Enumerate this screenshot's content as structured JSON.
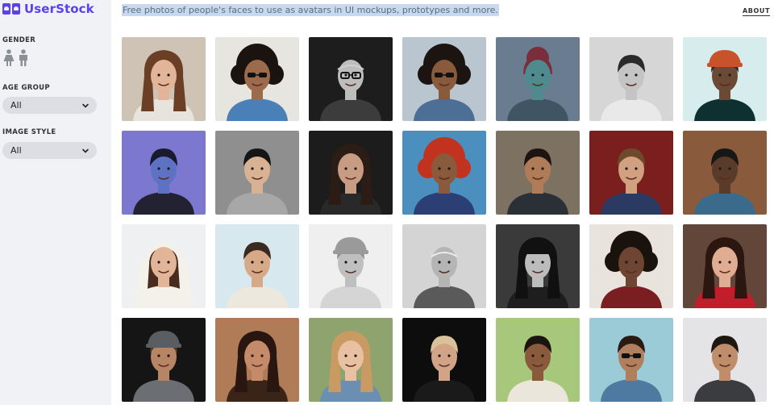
{
  "app": {
    "name": "UserStock",
    "brand_color": "#5b3ff0"
  },
  "sidebar": {
    "gender": {
      "label": "GENDER",
      "icons": [
        "female-person-icon",
        "male-person-icon"
      ]
    },
    "age_group": {
      "label": "AGE GROUP",
      "selected": "All"
    },
    "image_style": {
      "label": "IMAGE STYLE",
      "selected": "All"
    }
  },
  "header": {
    "tagline": "Free photos of people's faces to use as avatars in UI mockups, prototypes and more.",
    "about": "ABOUT"
  },
  "photos": [
    {
      "bg": "#cfc3b5",
      "skin": "#e2b598",
      "hair": "#6a3f25",
      "shirt": "#e6e4dc",
      "hairStyle": "long",
      "glasses": false,
      "hat": null
    },
    {
      "bg": "#e7e5e0",
      "skin": "#9c6b4c",
      "hair": "#1b1310",
      "shirt": "#4a80b7",
      "hairStyle": "curly",
      "glasses": "sun",
      "hat": null
    },
    {
      "bg": "#1d1d1d",
      "skin": "#bdbdbd",
      "hair": "#cfcfcf",
      "shirt": "#3c3c3c",
      "hairStyle": "bald",
      "glasses": "clear",
      "hat": null
    },
    {
      "bg": "#b9c6cf",
      "skin": "#8a5a3d",
      "hair": "#1c1410",
      "shirt": "#4d6f96",
      "hairStyle": "curly",
      "glasses": "sun",
      "hat": null
    },
    {
      "bg": "#6a7d90",
      "skin": "#4f8a8f",
      "hair": "#7a2e3c",
      "shirt": "#3f5563",
      "hairStyle": "bun",
      "glasses": false,
      "hat": null
    },
    {
      "bg": "#d6d6d6",
      "skin": "#c4c4c4",
      "hair": "#2a2a2a",
      "shirt": "#e9e9e9",
      "hairStyle": "short",
      "glasses": false,
      "hat": null
    },
    {
      "bg": "#d7ecec",
      "skin": "#6b4a35",
      "hair": "#3a2a20",
      "shirt": "#0f3030",
      "hairStyle": "short",
      "glasses": false,
      "hat": "#c8532b"
    },
    {
      "bg": "#7c77cf",
      "skin": "#5e72c4",
      "hair": "#1a1a2e",
      "shirt": "#222233",
      "hairStyle": "short",
      "glasses": false,
      "hat": null
    },
    {
      "bg": "#8f8f8f",
      "skin": "#d8b293",
      "hair": "#151515",
      "shirt": "#a7a7a7",
      "hairStyle": "short",
      "glasses": false,
      "hat": null
    },
    {
      "bg": "#1c1c1c",
      "skin": "#c89c82",
      "hair": "#2b1d16",
      "shirt": "#292929",
      "hairStyle": "long",
      "glasses": false,
      "hat": null
    },
    {
      "bg": "#4a8fbd",
      "skin": "#8a5a3d",
      "hair": "#c2331f",
      "shirt": "#2c3f74",
      "hairStyle": "curly",
      "glasses": false,
      "hat": null
    },
    {
      "bg": "#7d7261",
      "skin": "#b07c58",
      "hair": "#1c1410",
      "shirt": "#2a3036",
      "hairStyle": "short",
      "glasses": false,
      "hat": null
    },
    {
      "bg": "#7a1e1e",
      "skin": "#d1a07f",
      "hair": "#6e4a2c",
      "shirt": "#2b3a63",
      "hairStyle": "short",
      "glasses": false,
      "hat": null
    },
    {
      "bg": "#8a5a3c",
      "skin": "#5a3a28",
      "hair": "#171717",
      "shirt": "#3b6b8c",
      "hairStyle": "short",
      "glasses": false,
      "hat": null
    },
    {
      "bg": "#eef0f2",
      "skin": "#e2b598",
      "hair": "#4a2c1e",
      "shirt": "#f4f1ea",
      "hairStyle": "hood",
      "glasses": false,
      "hat": null
    },
    {
      "bg": "#d7e8ef",
      "skin": "#d6aa88",
      "hair": "#3a2a20",
      "shirt": "#ece8de",
      "hairStyle": "short",
      "glasses": false,
      "hat": null
    },
    {
      "bg": "#efefef",
      "skin": "#bfbfbf",
      "hair": "#8e8e8e",
      "shirt": "#d5d5d5",
      "hairStyle": "short",
      "glasses": false,
      "hat": "#9a9a9a"
    },
    {
      "bg": "#d4d4d4",
      "skin": "#b5b5b5",
      "hair": "#eaeaea",
      "shirt": "#5a5a5a",
      "hairStyle": "bald",
      "glasses": false,
      "hat": null
    },
    {
      "bg": "#3a3a3a",
      "skin": "#bcbcbc",
      "hair": "#101010",
      "shirt": "#1e1e1e",
      "hairStyle": "long",
      "glasses": false,
      "hat": "#111111"
    },
    {
      "bg": "#e9e3de",
      "skin": "#6d4532",
      "hair": "#1a120d",
      "shirt": "#7a1e22",
      "hairStyle": "curly",
      "glasses": false,
      "hat": null
    },
    {
      "bg": "#63463a",
      "skin": "#e0ad92",
      "hair": "#2b1710",
      "shirt": "#c21d2b",
      "hairStyle": "long",
      "glasses": false,
      "hat": null
    },
    {
      "bg": "#151515",
      "skin": "#b68566",
      "hair": "#4c3a2d",
      "shirt": "#6b6e73",
      "hairStyle": "short",
      "glasses": false,
      "hat": "#5a5d62"
    },
    {
      "bg": "#b07c58",
      "skin": "#c48a6a",
      "hair": "#2a1610",
      "shirt": "#3a2418",
      "hairStyle": "long",
      "glasses": false,
      "hat": null
    },
    {
      "bg": "#8fa36e",
      "skin": "#e8c1a2",
      "hair": "#c99a62",
      "shirt": "#6b8fb3",
      "hairStyle": "long",
      "glasses": false,
      "hat": null
    },
    {
      "bg": "#0d0d0d",
      "skin": "#d2a487",
      "hair": "#d9c29a",
      "shirt": "#1a1a1a",
      "hairStyle": "short",
      "glasses": false,
      "hat": null
    },
    {
      "bg": "#a7c77a",
      "skin": "#8a5a3d",
      "hair": "#1c1410",
      "shirt": "#eae6dc",
      "hairStyle": "short",
      "glasses": false,
      "hat": null
    },
    {
      "bg": "#9ccbd8",
      "skin": "#b0805e",
      "hair": "#2a1a12",
      "shirt": "#4e7aa1",
      "hairStyle": "short",
      "glasses": "sun",
      "hat": null
    },
    {
      "bg": "#e4e4e6",
      "skin": "#c08d6b",
      "hair": "#1e1610",
      "shirt": "#3a3c40",
      "hairStyle": "short",
      "glasses": false,
      "hat": null
    }
  ]
}
